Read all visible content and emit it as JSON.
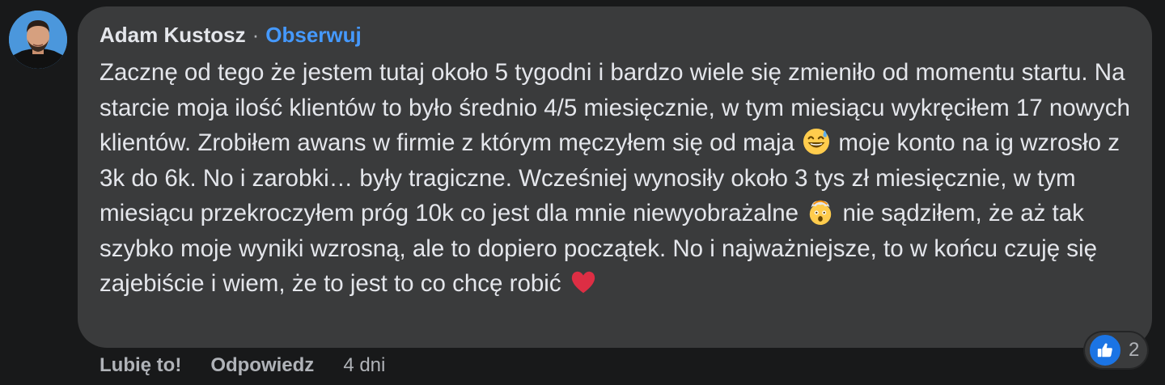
{
  "comment": {
    "author": "Adam Kustosz",
    "separator": "·",
    "follow_label": "Obserwuj",
    "text": {
      "part1": "Zacznę od tego że jestem tutaj około 5 tygodni i bardzo wiele się zmieniło od momentu startu. Na starcie moja ilość klientów to było średnio 4/5 miesięcznie, w tym miesiącu wykręciłem 17 nowych klientów. Zrobiłem awans w firmie z którym męczyłem się od maja",
      "part2": " moje konto na ig wzrosło z 3k do 6k. No i zarobki… były tragiczne. Wcześniej wynosiły około 3 tys zł miesięcznie, w tym miesiącu przekroczyłem próg 10k co jest dla mnie niewyobrażalne",
      "part3": " nie sądziłem, że aż tak szybko moje wyniki wzrosną, ale to dopiero początek. No i najważniejsze, to w końcu czuję się zajebiście i wiem, że to jest to co chcę robić",
      "emoji_icons": [
        "grinning-sweat-emoji-icon",
        "exploding-head-emoji-icon",
        "red-heart-emoji-icon"
      ]
    },
    "actions": {
      "like_label": "Lubię to!",
      "reply_label": "Odpowiedz",
      "timestamp": "4 dni"
    },
    "reactions": {
      "icon": "like-thumbs-up-icon",
      "count": "2"
    },
    "colors": {
      "background": "#18191a",
      "bubble": "#3a3b3c",
      "text": "#e4e6eb",
      "secondary_text": "#b0b3b8",
      "link": "#4599ff",
      "like_blue": "#1b74e4"
    }
  }
}
